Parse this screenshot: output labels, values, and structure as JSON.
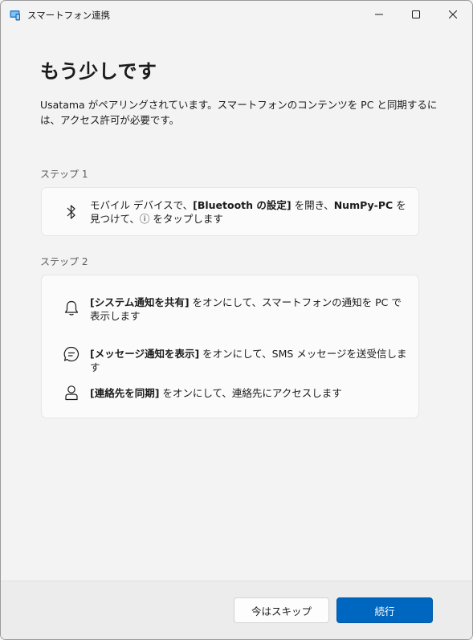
{
  "window": {
    "title": "スマートフォン連携",
    "icon": "phone-link-app-icon"
  },
  "main": {
    "heading": "もう少しです",
    "intro": "Usatama がペアリングされています。スマートフォンのコンテンツを PC と同期するには、アクセス許可が必要です。"
  },
  "step1": {
    "label": "ステップ 1",
    "icon": "bluetooth-icon",
    "text_pre": "モバイル デバイスで、",
    "text_bold1": "[Bluetooth の設定]",
    "text_mid": " を開き、",
    "text_bold2": "NumPy-PC",
    "text_post": " を見つけて、ⓘ をタップします"
  },
  "step2": {
    "label": "ステップ 2",
    "items": [
      {
        "icon": "bell-icon",
        "bold": "[システム通知を共有]",
        "text": " をオンにして、スマートフォンの通知を PC で表示します"
      },
      {
        "icon": "message-icon",
        "bold": "[メッセージ通知を表示]",
        "text": " をオンにして、SMS メッセージを送受信します"
      },
      {
        "icon": "contact-icon",
        "bold": "[連絡先を同期]",
        "text": " をオンにして、連絡先にアクセスします"
      }
    ]
  },
  "footer": {
    "skip_label": "今はスキップ",
    "next_label": "続行"
  },
  "colors": {
    "accent": "#0067c0",
    "background": "#f3f3f3",
    "card": "#fbfbfb"
  }
}
